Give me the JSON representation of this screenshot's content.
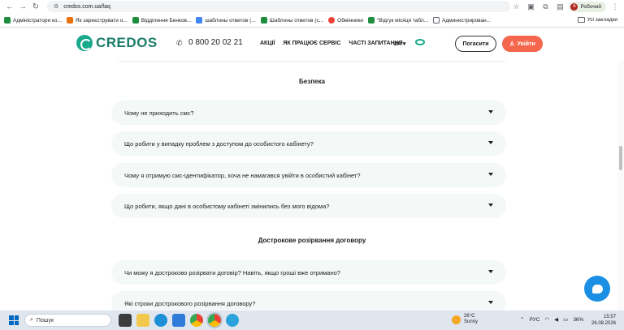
{
  "browser": {
    "url": "credos.com.ua/faq",
    "profile_label": "Робочий",
    "profile_initial": "А",
    "bookmarks": [
      {
        "label": "Адміністратори ко...",
        "color": "#1e8e3e"
      },
      {
        "label": "Як зареєструвати о...",
        "color": "#e8710a"
      },
      {
        "label": "Відділення Бенков...",
        "color": "#1e8e3e"
      },
      {
        "label": "шаблоны ответов (...",
        "color": "#4285f4"
      },
      {
        "label": "Шаблоны ответов (с...",
        "color": "#1e8e3e"
      },
      {
        "label": "Обмінники",
        "color": "#ea4335"
      },
      {
        "label": "\"Відгук місяця табл...",
        "color": "#1e8e3e"
      },
      {
        "label": "Администрирован...",
        "color": "#5f6368"
      }
    ],
    "all_bookmarks_label": "Усі закладки"
  },
  "site": {
    "logo_text": "CREDOS",
    "phone": "0 800 20 02 21",
    "menu": [
      "АКЦІЇ",
      "ЯК ПРАЦЮЄ СЕРВІС",
      "ЧАСТІ ЗАПИТАННЯ"
    ],
    "lang": "UA",
    "pay_label": "Погасити",
    "login_label": "Увійти",
    "accent_color": "#17a98c",
    "login_color": "#f5674d"
  },
  "faq": {
    "section1_title": "Безпека",
    "section1_items": [
      "Чому не приходить смс?",
      "Що робити у випадку проблем з доступом до особистого кабінету?",
      "Чому я отримую смс-ідентифікатор, хоча не намагався увійти в особистий кабінет?",
      "Що робити, якщо дані в особистому кабінеті змінились без мого відома?"
    ],
    "section2_title": "Дострокове розірвання договору",
    "section2_items": [
      "Чи можу я достроково розірвати договір? Навіть, якщо гроші вже отримано?",
      "Які строки дострокового розірвання договору?"
    ]
  },
  "taskbar": {
    "search_placeholder": "Пошук",
    "weather_temp": "26°C",
    "weather_desc": "Sunny",
    "lang": "РУС",
    "battery": "36%",
    "time": "15:57",
    "date": "26.08.2026"
  }
}
